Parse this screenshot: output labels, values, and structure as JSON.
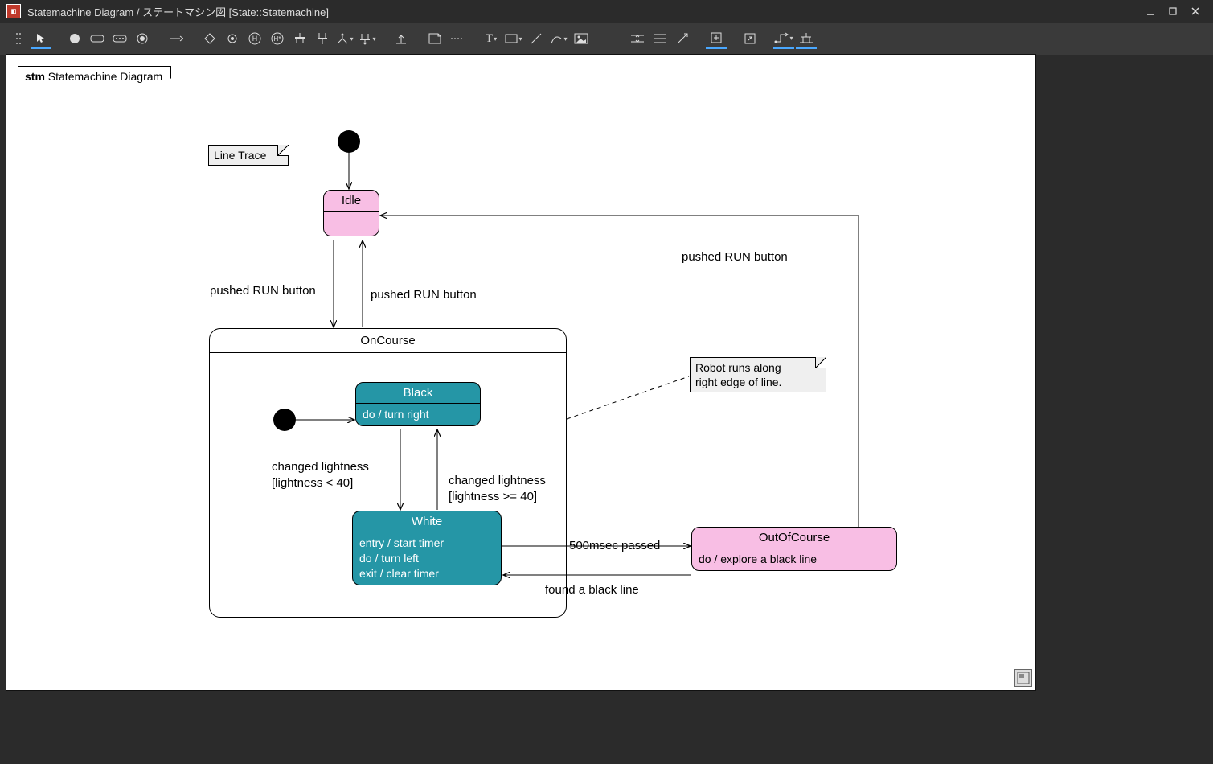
{
  "window": {
    "title": "Statemachine Diagram / ステートマシン図 [State::Statemachine]"
  },
  "toolbar": {
    "items": [
      "grip",
      "pointer",
      "initial-state",
      "submachine",
      "state",
      "region",
      "final-state",
      "arrow",
      "choice",
      "junction",
      "shallow-history",
      "deep-history",
      "fork",
      "join",
      "entry-point",
      "sep1",
      "exit-point",
      "terminate",
      "note",
      "rect",
      "sep2",
      "text",
      "sep3",
      "rect-tool",
      "line",
      "curve",
      "image",
      "sep4",
      "align-h",
      "align-v",
      "distribute",
      "fit",
      "zoom",
      "edge",
      "arrange"
    ]
  },
  "diagram": {
    "frame_prefix": "stm",
    "frame_title": "Statemachine Diagram",
    "notes": {
      "line_trace": "Line Trace",
      "robot_note_line1": "Robot runs along",
      "robot_note_line2": "right edge of line."
    },
    "states": {
      "idle": {
        "name": "Idle"
      },
      "oncourse": {
        "name": "OnCourse"
      },
      "black": {
        "name": "Black",
        "activity": "do / turn right"
      },
      "white": {
        "name": "White",
        "entry": "entry / start timer",
        "do": "do / turn left",
        "exit": "exit / clear timer"
      },
      "outofcourse": {
        "name": "OutOfCourse",
        "activity": "do / explore a black line"
      }
    },
    "transitions": {
      "t_idle_oncourse": "pushed RUN button",
      "t_oncourse_idle": "pushed RUN button",
      "t_outof_idle": "pushed RUN button",
      "t_black_white_l1": "changed lightness",
      "t_black_white_l2": "[lightness < 40]",
      "t_white_black_l1": "changed lightness",
      "t_white_black_l2": "[lightness >= 40]",
      "t_white_outof": "500msec passed",
      "t_outof_white": "found a black line"
    }
  }
}
